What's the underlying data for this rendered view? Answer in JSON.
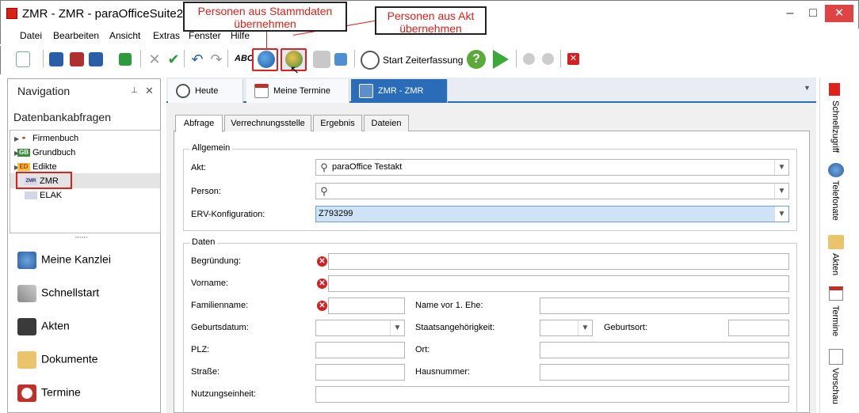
{
  "window": {
    "title": "ZMR - ZMR - paraOfficeSuite2011",
    "minimize": "–",
    "maximize": "□",
    "close": "✕"
  },
  "menu": [
    "Datei",
    "Bearbeiten",
    "Ansicht",
    "Extras",
    "Fenster",
    "Hilfe"
  ],
  "toolbar": {
    "spell_label": "ABC",
    "start_time_label": "Start Zeiterfassung"
  },
  "callouts": {
    "stammdaten": "Personen aus Stammdaten übernehmen",
    "akt": "Personen aus Akt übernehmen"
  },
  "navigation": {
    "title": "Navigation",
    "pin": "⊥",
    "close": "✕",
    "section": "Datenbankabfragen",
    "tree": [
      {
        "label": "Firmenbuch",
        "badge": "⚭"
      },
      {
        "label": "Grundbuch",
        "badge": "GB"
      },
      {
        "label": "Edikte",
        "badge": "ED"
      },
      {
        "label": "ZMR",
        "badge": "ZMR"
      },
      {
        "label": "ELAK",
        "badge": ""
      }
    ],
    "grip": "······",
    "buttons": [
      "Meine Kanzlei",
      "Schnellstart",
      "Akten",
      "Dokumente",
      "Termine"
    ]
  },
  "tabs": [
    "Heute",
    "Meine Termine",
    "ZMR - ZMR"
  ],
  "subtabs": [
    "Abfrage",
    "Verrechnungsstelle",
    "Ergebnis",
    "Dateien"
  ],
  "form": {
    "allgemein": {
      "title": "Allgemein",
      "akt_label": "Akt:",
      "akt_value": "paraOffice Testakt",
      "person_label": "Person:",
      "person_value": "",
      "erv_label": "ERV-Konfiguration:",
      "erv_value": "Z793299"
    },
    "daten": {
      "title": "Daten",
      "begruendung": "Begründung:",
      "vorname": "Vorname:",
      "familienname": "Familienname:",
      "name_vor_ehe": "Name vor 1. Ehe:",
      "geburtsdatum": "Geburtsdatum:",
      "staatsangehoerigkeit": "Staatsangehörigkeit:",
      "geburtsort": "Geburtsort:",
      "plz": "PLZ:",
      "ort": "Ort:",
      "strasse": "Straße:",
      "hausnummer": "Hausnummer:",
      "nutzungseinheit": "Nutzungseinheit:"
    }
  },
  "right_bar": [
    "Schnellzugriff",
    "Telefonate",
    "Akten",
    "Termine",
    "Vorschau"
  ],
  "colors": {
    "accent": "#2b6cb8",
    "error": "#d42020",
    "callout_text": "#e0201a"
  }
}
